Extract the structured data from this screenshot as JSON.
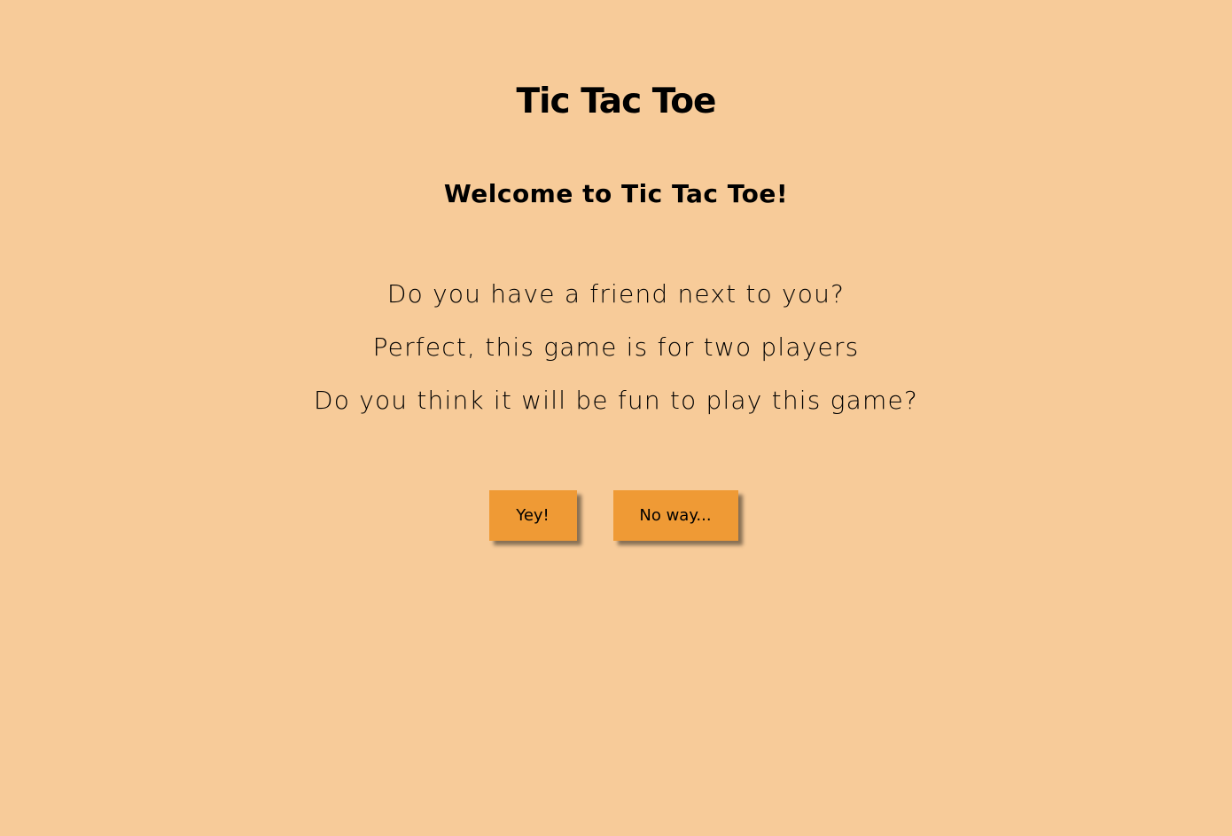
{
  "page": {
    "title": "Tic Tac Toe",
    "welcome": "Welcome to Tic Tac Toe!",
    "intro_lines": [
      "Do you have a friend next to you?",
      "Perfect, this game is for two players",
      "Do you think it will be fun to play this game?"
    ]
  },
  "actions": {
    "yes_label": "Yey!",
    "no_label": "No way..."
  },
  "colors": {
    "background": "#f7cb99",
    "button": "#ef9a35",
    "text": "#000000"
  }
}
